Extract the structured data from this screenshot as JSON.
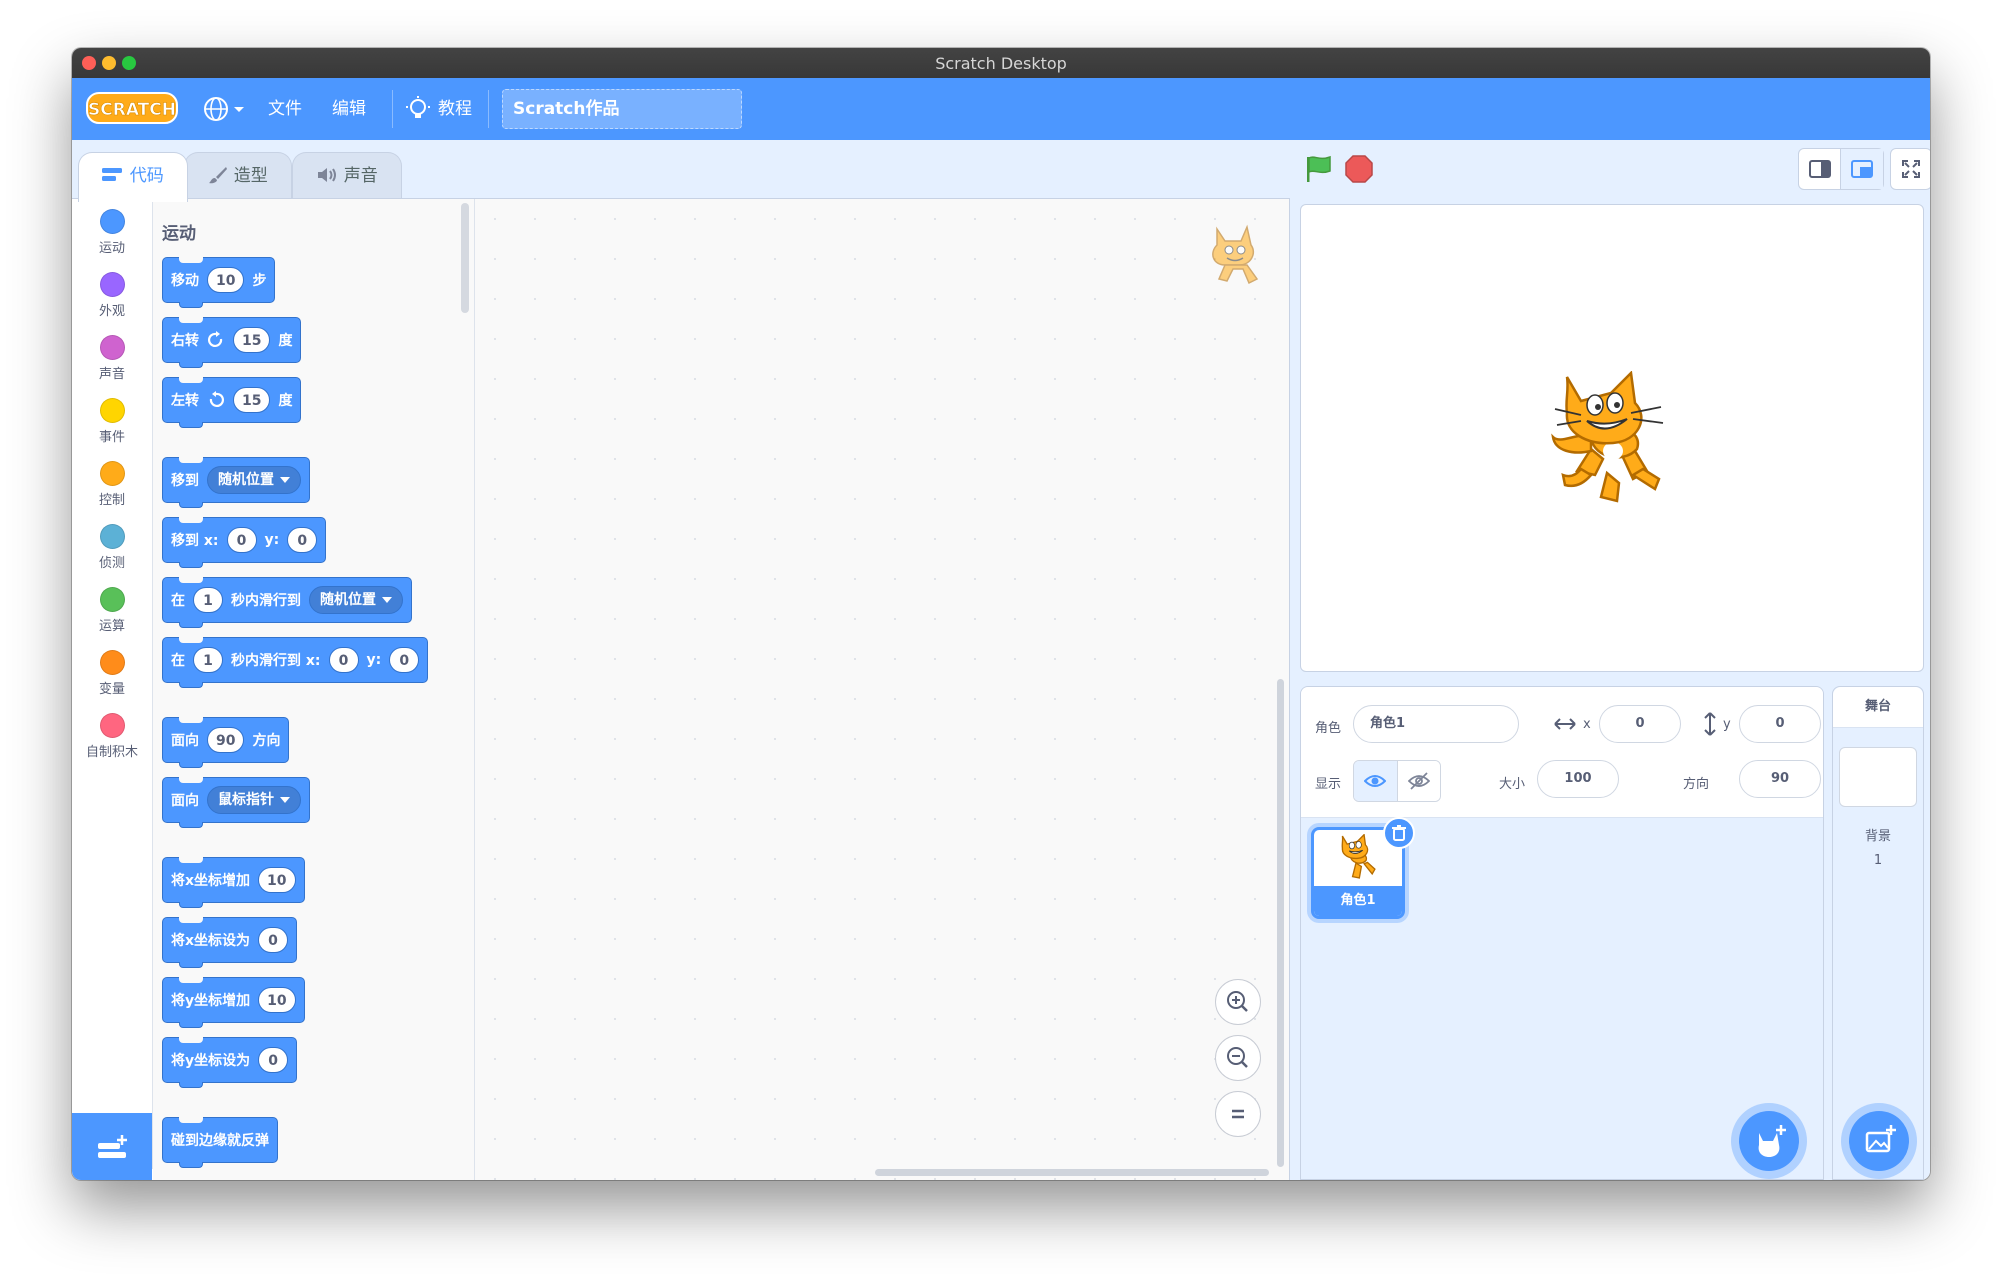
{
  "window": {
    "title": "Scratch Desktop"
  },
  "menu": {
    "logo": "SCRATCH",
    "file": "文件",
    "edit": "编辑",
    "tutorials": "教程",
    "project_title": "Scratch作品"
  },
  "tabs": {
    "code": "代码",
    "costumes": "造型",
    "sounds": "声音"
  },
  "categories": [
    {
      "label": "运动",
      "color": "#4c97ff"
    },
    {
      "label": "外观",
      "color": "#9966ff"
    },
    {
      "label": "声音",
      "color": "#cf63cf"
    },
    {
      "label": "事件",
      "color": "#ffd500"
    },
    {
      "label": "控制",
      "color": "#ffab19"
    },
    {
      "label": "侦测",
      "color": "#5cb1d6"
    },
    {
      "label": "运算",
      "color": "#59c059"
    },
    {
      "label": "变量",
      "color": "#ff8c1a"
    },
    {
      "label": "自制积木",
      "color": "#ff6680"
    }
  ],
  "palette": {
    "section": "运动",
    "move": {
      "pre": "移动",
      "val": "10",
      "post": "步"
    },
    "turn_right": {
      "pre": "右转",
      "val": "15",
      "post": "度"
    },
    "turn_left": {
      "pre": "左转",
      "val": "15",
      "post": "度"
    },
    "goto": {
      "pre": "移到",
      "menu": "随机位置"
    },
    "goto_xy": {
      "pre": "移到 x:",
      "x": "0",
      "ylabel": "y:",
      "y": "0"
    },
    "glide": {
      "pre": "在",
      "val": "1",
      "mid": "秒内滑行到",
      "menu": "随机位置"
    },
    "glide_xy": {
      "pre": "在",
      "val": "1",
      "mid": "秒内滑行到 x:",
      "x": "0",
      "ylabel": "y:",
      "y": "0"
    },
    "point_dir": {
      "pre": "面向",
      "val": "90",
      "post": "方向"
    },
    "point_towards": {
      "pre": "面向",
      "menu": "鼠标指针"
    },
    "change_x": {
      "pre": "将x坐标增加",
      "val": "10"
    },
    "set_x": {
      "pre": "将x坐标设为",
      "val": "0"
    },
    "change_y": {
      "pre": "将y坐标增加",
      "val": "10"
    },
    "set_y": {
      "pre": "将y坐标设为",
      "val": "0"
    },
    "bounce": {
      "pre": "碰到边缘就反弹"
    }
  },
  "sprite_info": {
    "sprite_label": "角色",
    "sprite_name": "角色1",
    "x_label": "x",
    "x": "0",
    "y_label": "y",
    "y": "0",
    "show_label": "显示",
    "size_label": "大小",
    "size": "100",
    "direction_label": "方向",
    "direction": "90"
  },
  "sprites": [
    {
      "name": "角色1"
    }
  ],
  "stage_panel": {
    "title": "舞台",
    "backdrops_label": "背景",
    "backdrops_count": "1"
  },
  "colors": {
    "accent": "#4c97ff",
    "motion": "#4c97ff",
    "cat_orange": "#ffab19"
  }
}
